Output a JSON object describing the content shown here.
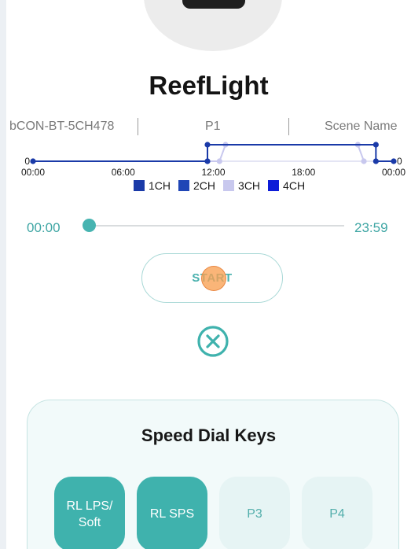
{
  "app": {
    "title": "ReefLight"
  },
  "device": {
    "name": "bCON-BT-5CH478",
    "program": "P1",
    "scene": "Scene Name"
  },
  "chart_data": {
    "type": "line",
    "x_ticks": [
      "00:00",
      "06:00",
      "12:00",
      "18:00",
      "00:00"
    ],
    "y_endpoint_labels": {
      "left": "0",
      "right": "0"
    },
    "legend": [
      {
        "label": "1CH",
        "color": "#1a3aa8"
      },
      {
        "label": "2CH",
        "color": "#2046b6"
      },
      {
        "label": "3CH",
        "color": "#c8c8ee"
      },
      {
        "label": "4CH",
        "color": "#0d1cd8"
      }
    ],
    "series": [
      {
        "name": "1CH",
        "color": "#1a3aa8",
        "points": [
          [
            "00:00",
            0
          ],
          [
            "11:36",
            0
          ],
          [
            "11:36",
            100
          ],
          [
            "22:48",
            100
          ],
          [
            "22:48",
            0
          ],
          [
            "23:59",
            0
          ]
        ]
      },
      {
        "name": "3CH",
        "color": "#c8c8ee",
        "points": [
          [
            "11:36",
            0
          ],
          [
            "12:24",
            0
          ],
          [
            "12:48",
            100
          ],
          [
            "21:36",
            100
          ],
          [
            "22:00",
            0
          ]
        ]
      }
    ]
  },
  "timeline": {
    "start": "00:00",
    "end": "23:59",
    "position": 0.0
  },
  "start_button": {
    "label": "START"
  },
  "icons": {
    "stop": "close-circle-icon"
  },
  "speed_dial": {
    "title": "Speed Dial Keys",
    "keys": [
      {
        "label": "RL LPS/ Soft",
        "active": true
      },
      {
        "label": "RL SPS",
        "active": true
      },
      {
        "label": "P3",
        "active": false
      },
      {
        "label": "P4",
        "active": false
      }
    ]
  },
  "colors": {
    "accent": "#3fb2ad",
    "background": "#ffffff",
    "chart_blue": "#1a3aa8",
    "chart_lavender": "#c8c8ee"
  }
}
